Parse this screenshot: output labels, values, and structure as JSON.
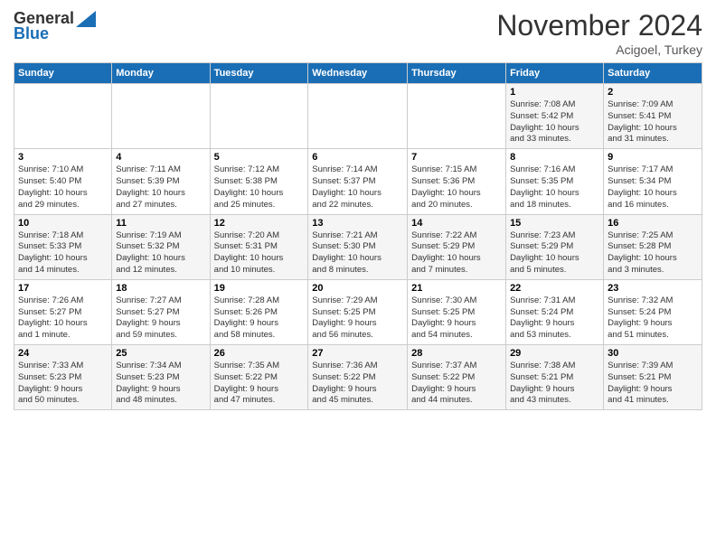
{
  "header": {
    "logo_line1": "General",
    "logo_line2": "Blue",
    "month": "November 2024",
    "location": "Acigoel, Turkey"
  },
  "weekdays": [
    "Sunday",
    "Monday",
    "Tuesday",
    "Wednesday",
    "Thursday",
    "Friday",
    "Saturday"
  ],
  "weeks": [
    [
      {
        "day": "",
        "info": ""
      },
      {
        "day": "",
        "info": ""
      },
      {
        "day": "",
        "info": ""
      },
      {
        "day": "",
        "info": ""
      },
      {
        "day": "",
        "info": ""
      },
      {
        "day": "1",
        "info": "Sunrise: 7:08 AM\nSunset: 5:42 PM\nDaylight: 10 hours\nand 33 minutes."
      },
      {
        "day": "2",
        "info": "Sunrise: 7:09 AM\nSunset: 5:41 PM\nDaylight: 10 hours\nand 31 minutes."
      }
    ],
    [
      {
        "day": "3",
        "info": "Sunrise: 7:10 AM\nSunset: 5:40 PM\nDaylight: 10 hours\nand 29 minutes."
      },
      {
        "day": "4",
        "info": "Sunrise: 7:11 AM\nSunset: 5:39 PM\nDaylight: 10 hours\nand 27 minutes."
      },
      {
        "day": "5",
        "info": "Sunrise: 7:12 AM\nSunset: 5:38 PM\nDaylight: 10 hours\nand 25 minutes."
      },
      {
        "day": "6",
        "info": "Sunrise: 7:14 AM\nSunset: 5:37 PM\nDaylight: 10 hours\nand 22 minutes."
      },
      {
        "day": "7",
        "info": "Sunrise: 7:15 AM\nSunset: 5:36 PM\nDaylight: 10 hours\nand 20 minutes."
      },
      {
        "day": "8",
        "info": "Sunrise: 7:16 AM\nSunset: 5:35 PM\nDaylight: 10 hours\nand 18 minutes."
      },
      {
        "day": "9",
        "info": "Sunrise: 7:17 AM\nSunset: 5:34 PM\nDaylight: 10 hours\nand 16 minutes."
      }
    ],
    [
      {
        "day": "10",
        "info": "Sunrise: 7:18 AM\nSunset: 5:33 PM\nDaylight: 10 hours\nand 14 minutes."
      },
      {
        "day": "11",
        "info": "Sunrise: 7:19 AM\nSunset: 5:32 PM\nDaylight: 10 hours\nand 12 minutes."
      },
      {
        "day": "12",
        "info": "Sunrise: 7:20 AM\nSunset: 5:31 PM\nDaylight: 10 hours\nand 10 minutes."
      },
      {
        "day": "13",
        "info": "Sunrise: 7:21 AM\nSunset: 5:30 PM\nDaylight: 10 hours\nand 8 minutes."
      },
      {
        "day": "14",
        "info": "Sunrise: 7:22 AM\nSunset: 5:29 PM\nDaylight: 10 hours\nand 7 minutes."
      },
      {
        "day": "15",
        "info": "Sunrise: 7:23 AM\nSunset: 5:29 PM\nDaylight: 10 hours\nand 5 minutes."
      },
      {
        "day": "16",
        "info": "Sunrise: 7:25 AM\nSunset: 5:28 PM\nDaylight: 10 hours\nand 3 minutes."
      }
    ],
    [
      {
        "day": "17",
        "info": "Sunrise: 7:26 AM\nSunset: 5:27 PM\nDaylight: 10 hours\nand 1 minute."
      },
      {
        "day": "18",
        "info": "Sunrise: 7:27 AM\nSunset: 5:27 PM\nDaylight: 9 hours\nand 59 minutes."
      },
      {
        "day": "19",
        "info": "Sunrise: 7:28 AM\nSunset: 5:26 PM\nDaylight: 9 hours\nand 58 minutes."
      },
      {
        "day": "20",
        "info": "Sunrise: 7:29 AM\nSunset: 5:25 PM\nDaylight: 9 hours\nand 56 minutes."
      },
      {
        "day": "21",
        "info": "Sunrise: 7:30 AM\nSunset: 5:25 PM\nDaylight: 9 hours\nand 54 minutes."
      },
      {
        "day": "22",
        "info": "Sunrise: 7:31 AM\nSunset: 5:24 PM\nDaylight: 9 hours\nand 53 minutes."
      },
      {
        "day": "23",
        "info": "Sunrise: 7:32 AM\nSunset: 5:24 PM\nDaylight: 9 hours\nand 51 minutes."
      }
    ],
    [
      {
        "day": "24",
        "info": "Sunrise: 7:33 AM\nSunset: 5:23 PM\nDaylight: 9 hours\nand 50 minutes."
      },
      {
        "day": "25",
        "info": "Sunrise: 7:34 AM\nSunset: 5:23 PM\nDaylight: 9 hours\nand 48 minutes."
      },
      {
        "day": "26",
        "info": "Sunrise: 7:35 AM\nSunset: 5:22 PM\nDaylight: 9 hours\nand 47 minutes."
      },
      {
        "day": "27",
        "info": "Sunrise: 7:36 AM\nSunset: 5:22 PM\nDaylight: 9 hours\nand 45 minutes."
      },
      {
        "day": "28",
        "info": "Sunrise: 7:37 AM\nSunset: 5:22 PM\nDaylight: 9 hours\nand 44 minutes."
      },
      {
        "day": "29",
        "info": "Sunrise: 7:38 AM\nSunset: 5:21 PM\nDaylight: 9 hours\nand 43 minutes."
      },
      {
        "day": "30",
        "info": "Sunrise: 7:39 AM\nSunset: 5:21 PM\nDaylight: 9 hours\nand 41 minutes."
      }
    ]
  ]
}
